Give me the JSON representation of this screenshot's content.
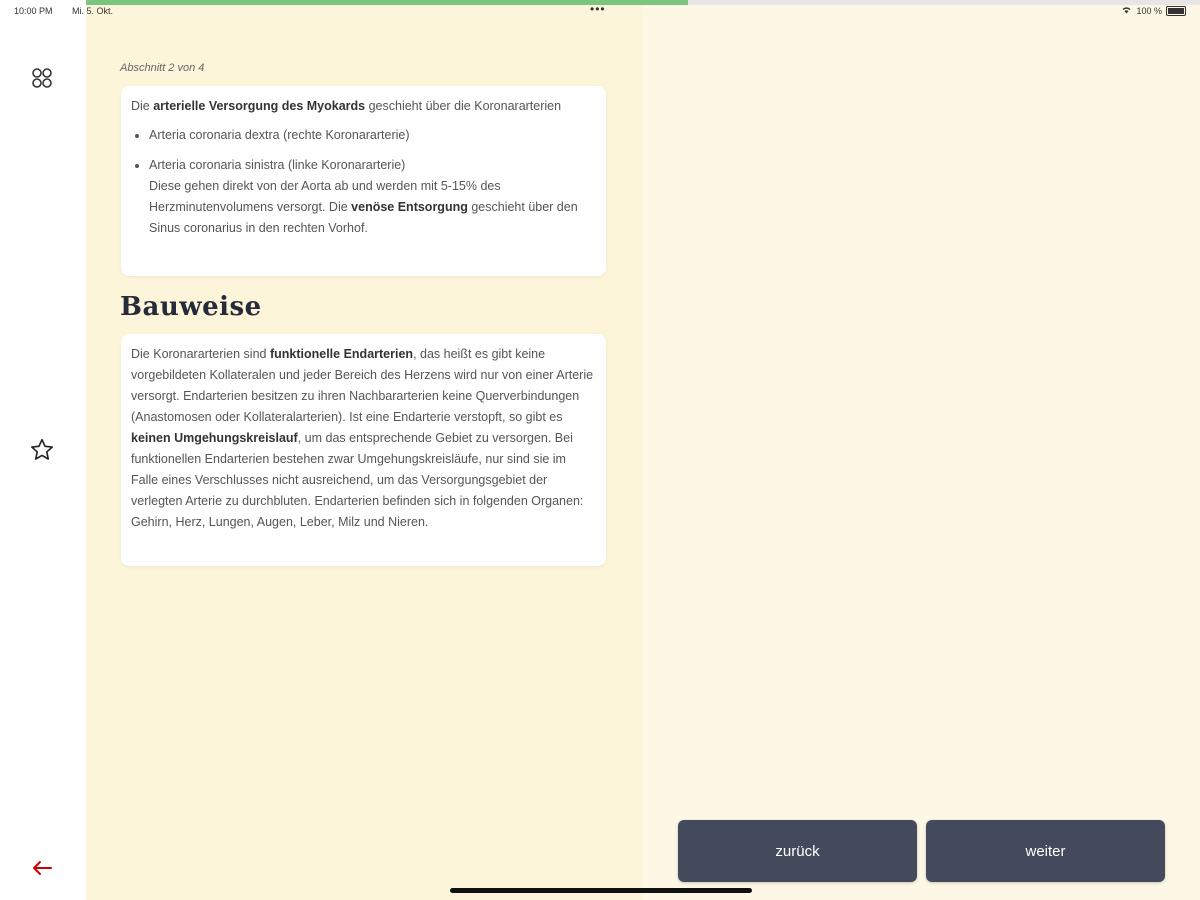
{
  "status": {
    "time": "10:00 PM",
    "date": "Mi. 5. Okt.",
    "battery": "100 %"
  },
  "progress": {
    "fraction": 0.54,
    "color": "#7cc57f"
  },
  "sidebar": {
    "grid_icon": "grid-icon",
    "star_icon": "star-icon",
    "back_icon": "arrow-left-icon",
    "back_icon_color": "#cc0000"
  },
  "section_label": "Abschnitt 2 von 4",
  "card1": {
    "intro_pre": "Die ",
    "intro_bold": "arterielle Versorgung des Myokards",
    "intro_post": " geschieht über die Koronararterien",
    "bullet1": "Arteria coronaria dextra (rechte Koronararterie)",
    "bullet2": "Arteria coronaria sinistra (linke Koronararterie)",
    "detail_pre": "Diese gehen direkt von der Aorta ab und werden mit 5-15% des Herzminutenvolumens versorgt. Die ",
    "detail_bold": "venöse Entsorgung",
    "detail_post": " geschieht über den Sinus coronarius in den rechten Vorhof."
  },
  "heading": "Bauweise",
  "card2": {
    "t1": "Die Koronararterien sind ",
    "b1": "funktionelle Endarterien",
    "t2": ", das heißt es gibt keine vorgebildeten Kollateralen und jeder Bereich des Herzens wird nur von einer Arterie versorgt. Endarterien besitzen zu ihren Nachbararterien keine Querverbindungen (Anastomosen oder Kollateralarterien). Ist eine Endarterie verstopft, so gibt es ",
    "b2": "keinen Umgehungskreislauf",
    "t3": ", um das entsprechende Gebiet zu versorgen. Bei funktionellen Endarterien bestehen zwar Umgehungskreisläufe, nur sind sie im Falle eines Verschlusses nicht ausreichend, um das Versorgungsgebiet der verlegten Arterie zu durchbluten. Endarterien befinden sich in folgenden Organen: Gehirn, Herz, Lungen, Augen, Leber, Milz und Nieren."
  },
  "buttons": {
    "back": "zurück",
    "next": "weiter"
  }
}
